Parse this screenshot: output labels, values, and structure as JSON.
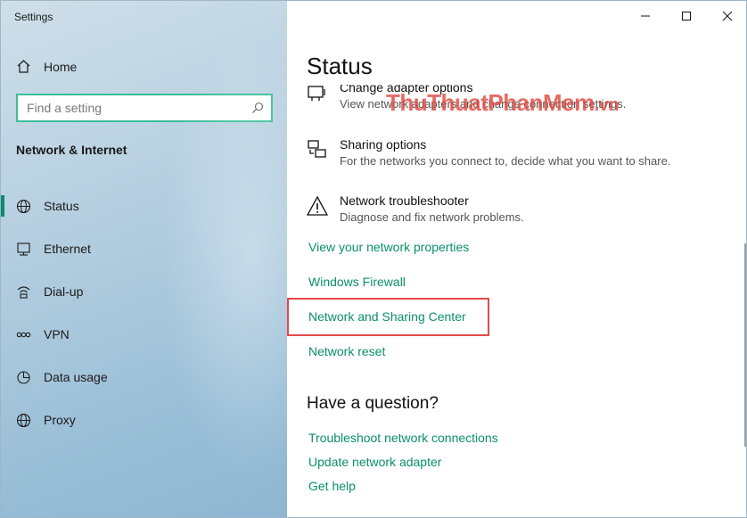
{
  "window": {
    "title": "Settings"
  },
  "sidebar": {
    "home_label": "Home",
    "search_placeholder": "Find a setting",
    "section_title": "Network & Internet",
    "items": [
      {
        "label": "Status",
        "icon": "globe-icon",
        "active": true
      },
      {
        "label": "Ethernet",
        "icon": "ethernet-icon"
      },
      {
        "label": "Dial-up",
        "icon": "dial-up-icon"
      },
      {
        "label": "VPN",
        "icon": "vpn-icon"
      },
      {
        "label": "Data usage",
        "icon": "data-usage-icon"
      },
      {
        "label": "Proxy",
        "icon": "globe-icon"
      }
    ]
  },
  "main": {
    "title": "Status",
    "options": [
      {
        "title": "Change adapter options",
        "desc": "View network adapters and change connection settings.",
        "icon": "adapter-icon"
      },
      {
        "title": "Sharing options",
        "desc": "For the networks you connect to, decide what you want to share.",
        "icon": "sharing-icon"
      },
      {
        "title": "Network troubleshooter",
        "desc": "Diagnose and fix network problems.",
        "icon": "warning-icon"
      }
    ],
    "links": [
      "View your network properties",
      "Windows Firewall",
      "Network and Sharing Center",
      "Network reset"
    ],
    "question_title": "Have a question?",
    "help_links": [
      "Troubleshoot network connections",
      "Update network adapter",
      "Get help"
    ]
  },
  "watermark": {
    "part1": "Thu",
    "part2": "Thuat",
    "part3": "PhanMem",
    "part4": ".vn"
  },
  "colors": {
    "accent": "#0a8f6c",
    "search_border": "#3bbd9b",
    "highlight": "#e24a4a"
  }
}
